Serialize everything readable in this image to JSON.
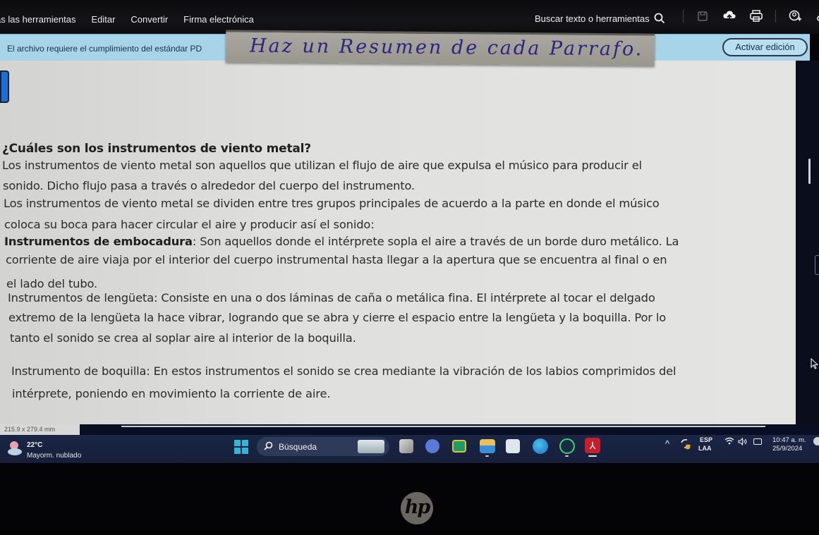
{
  "toolbar": {
    "menu": [
      "as las herramientas",
      "Editar",
      "Convertir",
      "Firma electrónica"
    ],
    "search_label": "Buscar texto o herramientas",
    "icons": [
      "search-icon",
      "save-icon",
      "upload-cloud-icon",
      "print-icon",
      "add-user-icon",
      "link-icon"
    ]
  },
  "banner": {
    "text": "El archivo requiere el cumplimiento del estándar PD",
    "button": "Activar edición"
  },
  "note": {
    "text": "Haz un Resumen de cada Parrafo."
  },
  "document": {
    "heading": "¿Cuáles son los instrumentos de viento metal?",
    "lines": [
      {
        "bold": "",
        "text": "Los instrumentos de viento metal son aquellos que utilizan el flujo de aire que expulsa el músico para producir el"
      },
      {
        "bold": "",
        "text": "sonido. Dicho flujo pasa a través o alrededor del cuerpo del instrumento."
      },
      {
        "bold": "",
        "text": "Los instrumentos de viento metal se dividen entre tres grupos principales de acuerdo a la parte en donde el músico"
      },
      {
        "bold": "",
        "text": "coloca su boca para hacer circular el aire y producir así el sonido:"
      },
      {
        "bold": "Instrumentos de embocadura",
        "text": ": Son aquellos donde el intérprete sopla el aire a través de un borde duro metálico. La"
      },
      {
        "bold": "",
        "text": "corriente de aire viaja por el interior del cuerpo instrumental hasta llegar a la apertura que se encuentra al final o en"
      },
      {
        "bold": "",
        "text": "el lado del tubo."
      },
      {
        "bold": "",
        "text": "Instrumentos de lengüeta: Consiste en una o dos láminas de caña o metálica fina. El intérprete al tocar el delgado"
      },
      {
        "bold": "",
        "text": "extremo de la lengüeta la hace vibrar, logrando que se abra y cierre el espacio entre la lengüeta y la boquilla. Por lo"
      },
      {
        "bold": "",
        "text": "tanto el sonido se crea al soplar aire al interior de la boquilla."
      },
      {
        "bold": "",
        "text": "Instrumento de boquilla: En estos instrumentos el sonido se crea mediante la vibración de los labios comprimidos del"
      },
      {
        "bold": "",
        "text": "intérprete, poniendo en movimiento la corriente de aire."
      }
    ],
    "page_size": "215.9 x 279.4 mm"
  },
  "taskbar": {
    "weather_temp": "22°C",
    "weather_desc": "Mayorm. nublado",
    "search_label": "Búsqueda",
    "apps": [
      "task-view",
      "meet",
      "classroom",
      "file-explorer",
      "microsoft-store",
      "edge",
      "whatsapp",
      "acrobat"
    ],
    "lang_top": "ESP",
    "lang_bottom": "LAA",
    "time": "10:47 a. m.",
    "date": "25/9/2024"
  },
  "bezel": {
    "logo": "hp"
  }
}
